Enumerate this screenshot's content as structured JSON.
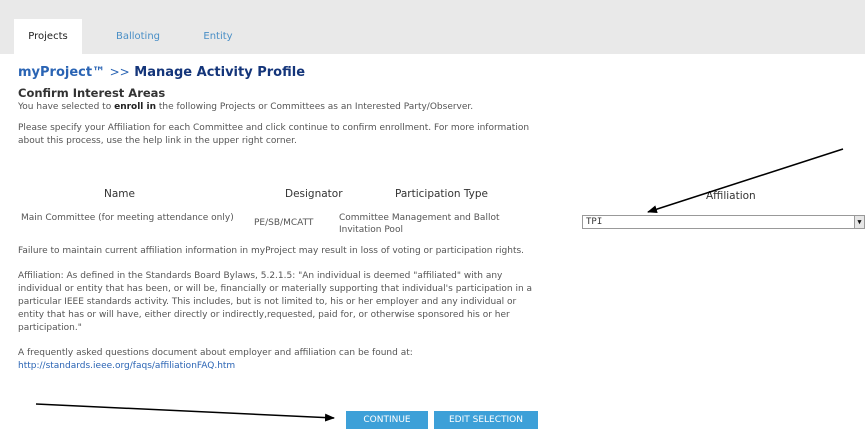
{
  "tabs": [
    {
      "label": "Projects",
      "active": true
    },
    {
      "label": "Balloting",
      "active": false
    },
    {
      "label": "Entity",
      "active": false
    }
  ],
  "header": {
    "brand": "myProject™",
    "separator": ">>",
    "page_title": "Manage Activity Profile"
  },
  "confirm": {
    "heading": "Confirm Interest Areas",
    "intro_pre": "You have selected to",
    "intro_bold": "enroll in",
    "intro_post": "the following Projects or Committees as an Interested Party/Observer.",
    "instructions": "Please specify your Affiliation for each Committee and click continue to confirm enrollment. For more information about this process, use the help link in the upper right corner."
  },
  "table": {
    "headers": {
      "name": "Name",
      "designator": "Designator",
      "participation_type": "Participation Type",
      "affiliation": "Affiliation"
    },
    "rows": [
      {
        "name": "Main Committee (for meeting attendance only)",
        "designator": "PE/SB/MCATT",
        "participation_type": "Committee Management and Ballot Invitation Pool",
        "affiliation": "TPI"
      }
    ]
  },
  "notes": {
    "warning": "Failure to maintain current affiliation information in myProject may result in loss of voting or participation rights.",
    "definition": "Affiliation: As defined in the Standards Board Bylaws, 5.2.1.5: \"An individual is deemed \"affiliated\" with any individual or entity that has been, or will be, financially or materially supporting that individual's participation in a particular IEEE standards activity. This includes, but is not limited to, his or her employer and any individual or entity that has or will have, either directly or indirectly,requested, paid for, or otherwise sponsored his or her participation.\"",
    "faq_text": "A frequently asked questions document about employer and affiliation can be found at:",
    "faq_link": "http://standards.ieee.org/faqs/affiliationFAQ.htm"
  },
  "buttons": {
    "continue": "CONTINUE",
    "edit_selection": "EDIT SELECTION"
  },
  "colors": {
    "brand": "#14357a",
    "link": "#2a64b4",
    "button": "#3da0d8"
  }
}
